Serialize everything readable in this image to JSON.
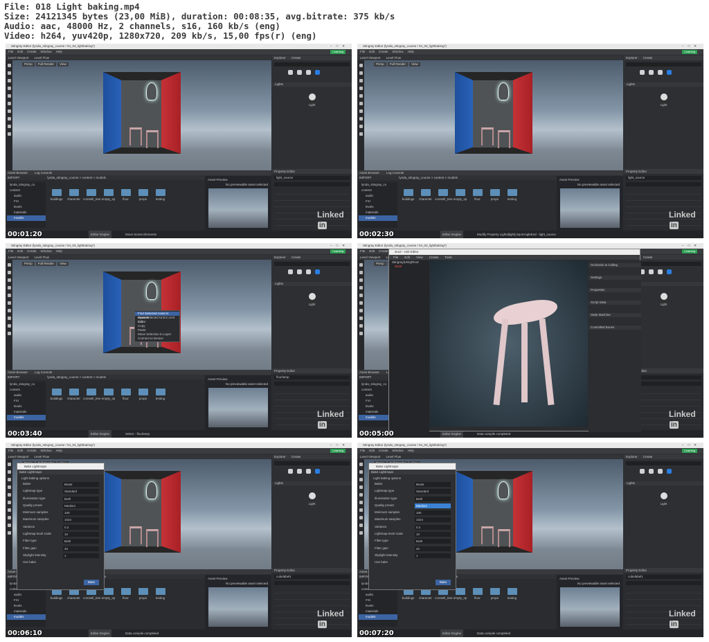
{
  "header": {
    "file": "File: 018 Light baking.mp4",
    "size": "Size: 24121345 bytes (23,00 MiB), duration: 00:08:35, avg.bitrate: 375 kb/s",
    "audio": "Audio: aac, 48000 Hz, 2 channels, s16, 160 kb/s (eng)",
    "video": "Video: h264, yuv420p, 1280x720, 209 kb/s, 15,00 fps(r) (eng)"
  },
  "app": {
    "window_title": "Stingray Editor (lynda_stingray_course / 04_03_lightbaking*)",
    "menus": [
      "File",
      "Edit",
      "Create",
      "Window",
      "Help"
    ],
    "learning": "Learning",
    "viewport_tabs": [
      "Level Viewport",
      "Level Flow"
    ],
    "viewport_buttons": [
      "Persp",
      "Full Render",
      "View"
    ],
    "explorer_tabs": [
      "Explorer",
      "Create"
    ],
    "search_placeholder": "Search",
    "create_categories": [
      "Objects",
      "Helpers",
      "Camera",
      "Lights"
    ],
    "lights_section": "Lights",
    "light_item": "Light",
    "property_editor": "Property Editor",
    "asset_tabs": [
      "Asset Browser",
      "Log Console"
    ],
    "import": "IMPORT",
    "breadcrumb": "lynda_stingray_course > content > models",
    "tree": [
      "lynda_stingray_co",
      "content",
      "audio",
      "FXI",
      "levels",
      "materials",
      "models"
    ],
    "folders": [
      "buildings",
      "character",
      "constell_tree",
      "empty_sp",
      "floor",
      "props",
      "testing"
    ],
    "asset_preview": "Asset Preview",
    "no_preview": "No previewable asset selected",
    "engine": "Editor Engine",
    "watermark": "Linked",
    "watermark_in": "in"
  },
  "thumbs": [
    {
      "time": "00:01:20",
      "status": "Move Scene Elements",
      "pe_field": "light_source"
    },
    {
      "time": "00:02:30",
      "status": "Modify Property Lights[light].SpotAngleEnd - light_source",
      "pe_field": "light_source"
    },
    {
      "time": "00:03:40",
      "status": "Select - floorlamp",
      "pe_field": "floorlamp",
      "context_menu": [
        "Find Selected Asset in Browser",
        "Open Selected Unit in Unit Editor",
        "Cut",
        "Copy",
        "Paste",
        "Move Selection to Layer",
        "Connect to Device"
      ]
    },
    {
      "time": "00:05:00",
      "status": "Data compile completed",
      "pe_field": "floorlamp",
      "unit_editor": {
        "title": "stool - Unit Editor",
        "menus": [
          "File",
          "Edit",
          "View",
          "Create",
          "Tools"
        ],
        "outline": [
          "Stingray|Unity|Root",
          "Stool"
        ],
        "props": [
          "Occlusion & Culling",
          "Settings",
          "Properties",
          "Script Data",
          "State Machine",
          "Controlled Bones"
        ]
      }
    },
    {
      "time": "00:06:10",
      "status": "Data compile completed",
      "pe_field": "cubelabel1",
      "hl_index": -1
    },
    {
      "time": "00:07:20",
      "status": "Data compile completed",
      "pe_field": "cubelabel1",
      "hl_index": 3
    }
  ],
  "bake": {
    "title": "Bake Lightmaps",
    "tab": "Bake Lightmaps",
    "section": "Light baking options",
    "rows": [
      {
        "label": "Baker",
        "value": "Beast"
      },
      {
        "label": "Lightmap type",
        "value": "Standard"
      },
      {
        "label": "Illumination type",
        "value": "Both"
      },
      {
        "label": "Quality preset",
        "value": "Medium"
      },
      {
        "label": "Minimum samples",
        "value": "100"
      },
      {
        "label": "Maximum samples",
        "value": "1024"
      },
      {
        "label": "Variance",
        "value": "0.2"
      },
      {
        "label": "Lightmap texel scale",
        "value": "10"
      },
      {
        "label": "Filter type",
        "value": "Both"
      },
      {
        "label": "Filter gain",
        "value": "40"
      },
      {
        "label": "Skylight intensity",
        "value": "1"
      },
      {
        "label": "Use bake",
        "value": ""
      }
    ],
    "bake_button": "Bake"
  }
}
